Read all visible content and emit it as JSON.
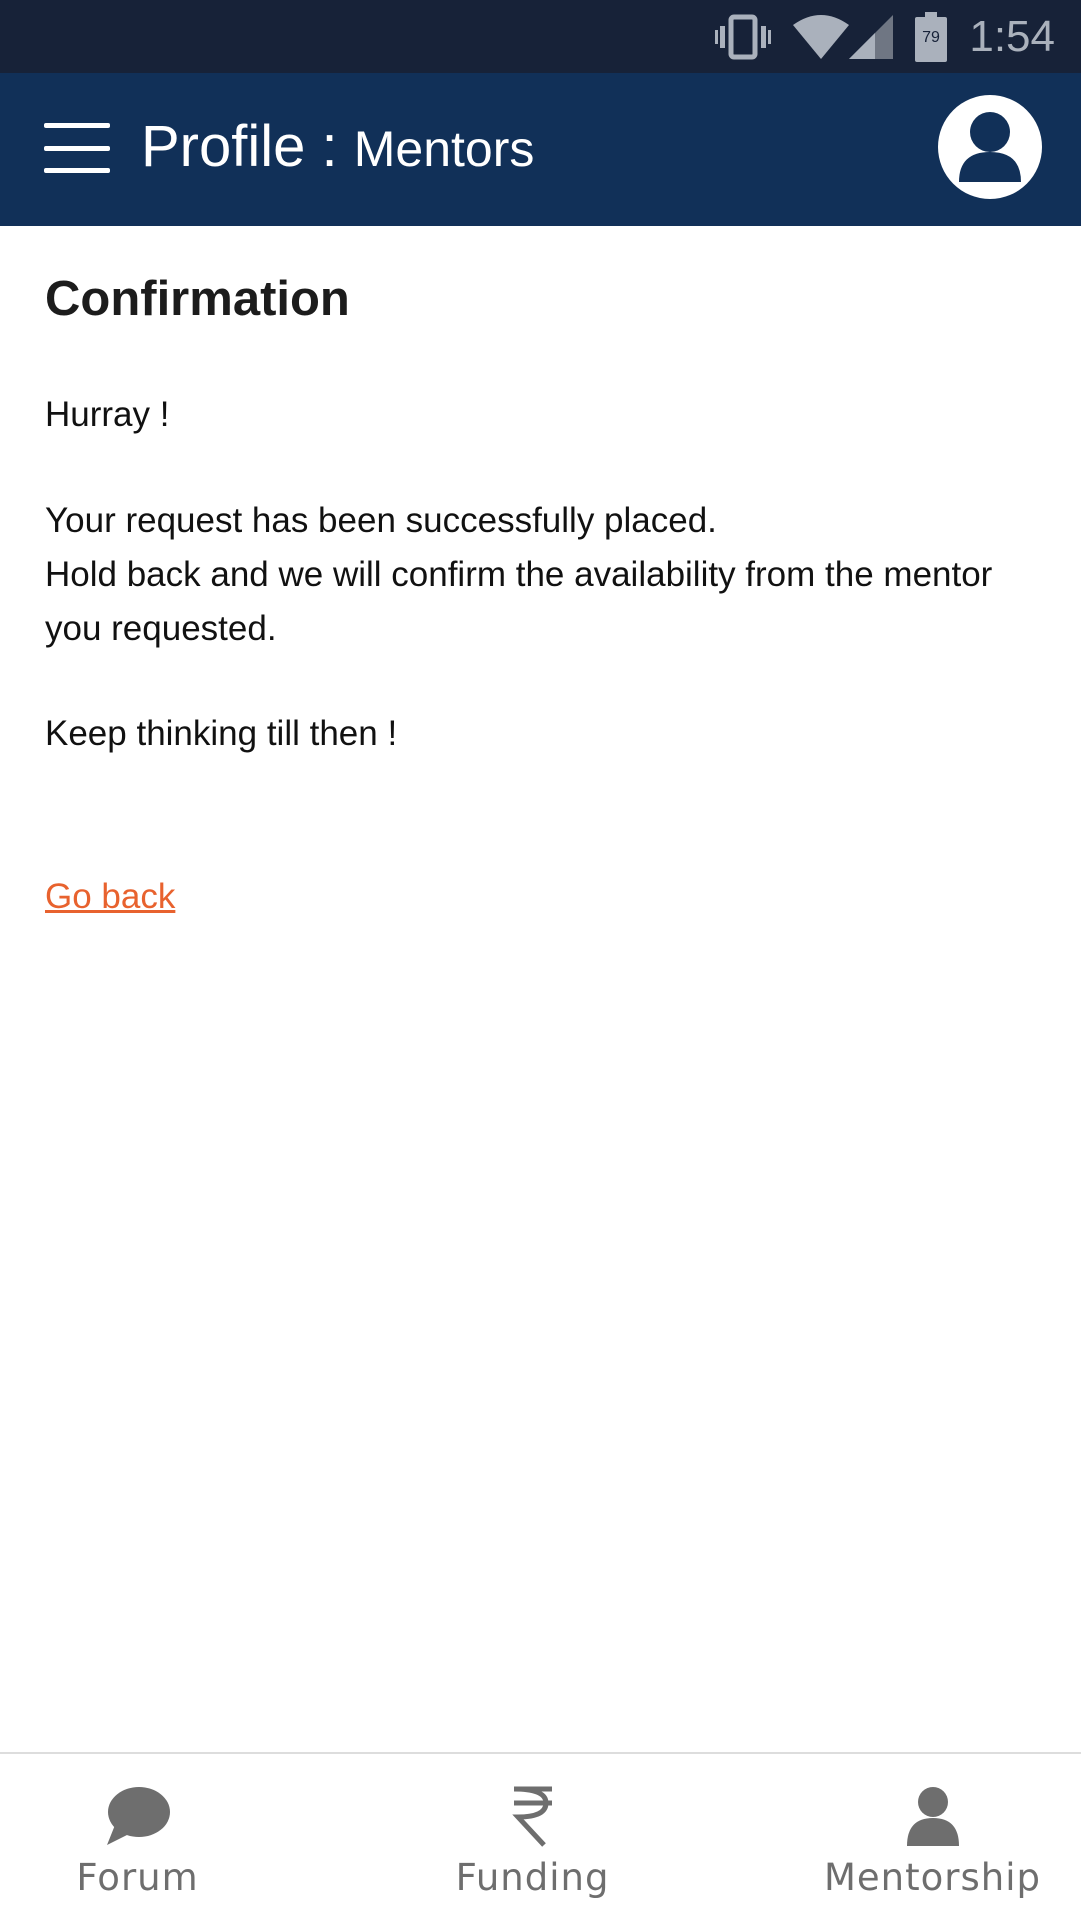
{
  "status_bar": {
    "time": "1:54",
    "battery_level": "79",
    "icons": [
      "vibrate-icon",
      "wifi-icon",
      "signal-icon",
      "battery-icon"
    ]
  },
  "app_bar": {
    "title_main": "Profile",
    "title_separator": " : ",
    "title_sub": "Mentors",
    "menu_icon": "hamburger-menu-icon",
    "avatar_icon": "user-avatar-icon"
  },
  "content": {
    "heading": "Confirmation",
    "line1": "Hurray !",
    "line2": "Your request has been successfully placed.",
    "line3": "Hold back and we will confirm the availability from the mentor",
    "line4": "you requested.",
    "line5": "Keep thinking till then !",
    "go_back": "Go back"
  },
  "bottom_nav": {
    "items": [
      {
        "label": "Forum",
        "icon": "chat-bubble-icon"
      },
      {
        "label": "Funding",
        "icon": "rupee-icon"
      },
      {
        "label": "Mentorship",
        "icon": "person-icon"
      }
    ]
  },
  "colors": {
    "status_bar_bg": "#172238",
    "app_bar_bg": "#113058",
    "link": "#e8622e",
    "nav_icon": "#6e6e6e"
  }
}
